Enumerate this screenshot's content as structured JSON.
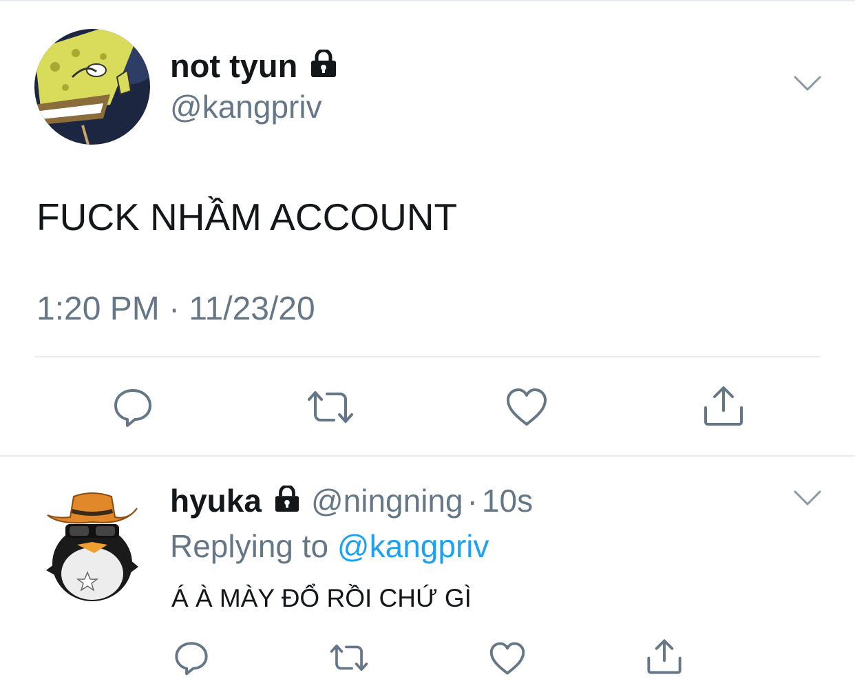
{
  "main_tweet": {
    "display_name": "not tyun",
    "handle": "@kangpriv",
    "text": "FUCK NHẦM ACCOUNT",
    "timestamp": "1:20 PM · 11/23/20",
    "avatar_icon": "spongebob-avatar",
    "protected_icon": "lock-icon"
  },
  "reply_tweet": {
    "display_name": "hyuka",
    "handle": "@ningning",
    "separator": "·",
    "time_ago": "10s",
    "replying_label": "Replying to",
    "replying_to": "@kangpriv",
    "text": "Á À MÀY ĐỔ RỒI CHỨ GÌ",
    "avatar_icon": "cowboy-penguin-avatar",
    "protected_icon": "lock-icon"
  },
  "action_icons": [
    "reply-icon",
    "retweet-icon",
    "like-icon",
    "share-icon"
  ],
  "colors": {
    "text": "#14171a",
    "secondary": "#657786",
    "link": "#1da1f2",
    "divider": "#e6ecf0"
  }
}
